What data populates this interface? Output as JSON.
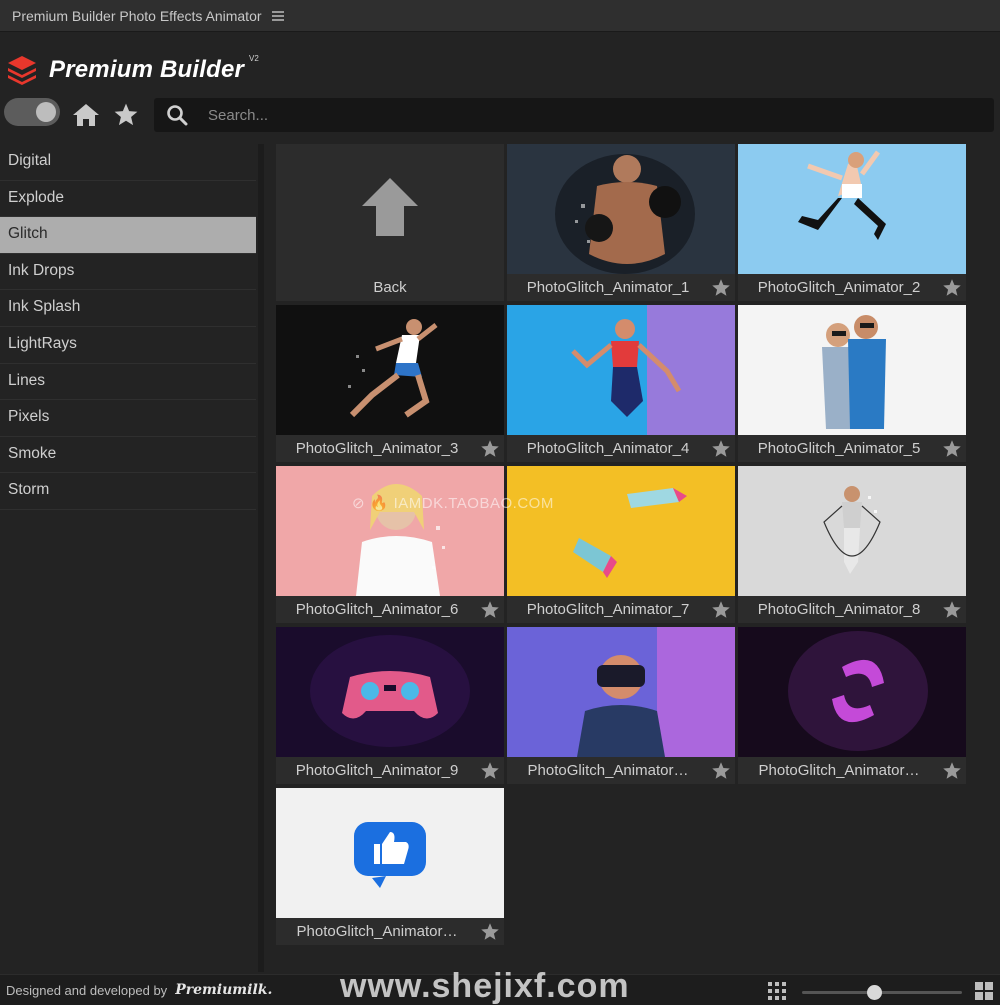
{
  "window": {
    "title": "Premium Builder Photo Effects Animator"
  },
  "brand": {
    "name": "Premium Builder",
    "version": "V2",
    "logo_icon": "layers-icon",
    "logo_color": "#e8372c"
  },
  "toolbar": {
    "toggle_icon": "toggle-switch-icon",
    "home_icon": "home-icon",
    "favorites_icon": "star-icon"
  },
  "search": {
    "placeholder": "Search...",
    "value": ""
  },
  "sidebar": {
    "selected": "Glitch",
    "items": [
      {
        "label": "Digital"
      },
      {
        "label": "Explode"
      },
      {
        "label": "Glitch"
      },
      {
        "label": "Ink Drops"
      },
      {
        "label": "Ink Splash"
      },
      {
        "label": "LightRays"
      },
      {
        "label": "Lines"
      },
      {
        "label": "Pixels"
      },
      {
        "label": "Smoke"
      },
      {
        "label": "Storm"
      }
    ]
  },
  "grid": {
    "back_label": "Back",
    "back_icon": "arrow-up-icon",
    "items": [
      {
        "label": "PhotoGlitch_Animator_1",
        "bg": "#2a3440",
        "scene": "boxer"
      },
      {
        "label": "PhotoGlitch_Animator_2",
        "bg": "#8ccbf0",
        "scene": "jumper"
      },
      {
        "label": "PhotoGlitch_Animator_3",
        "bg": "#141414",
        "scene": "runner"
      },
      {
        "label": "PhotoGlitch_Animator_4",
        "bg": "#2aa4e6",
        "scene": "dancer"
      },
      {
        "label": "PhotoGlitch_Animator_5",
        "bg": "#f4f4f4",
        "scene": "couple"
      },
      {
        "label": "PhotoGlitch_Animator_6",
        "bg": "#f0a7a8",
        "scene": "woman"
      },
      {
        "label": "PhotoGlitch_Animator_7",
        "bg": "#f3bf25",
        "scene": "sneakers"
      },
      {
        "label": "PhotoGlitch_Animator_8",
        "bg": "#d9d9d9",
        "scene": "ropejump"
      },
      {
        "label": "PhotoGlitch_Animator_9",
        "bg": "#1d1030",
        "scene": "gamepad"
      },
      {
        "label": "PhotoGlitch_Animator…",
        "bg": "#6b63d8",
        "scene": "vr"
      },
      {
        "label": "PhotoGlitch_Animator…",
        "bg": "#1c0e22",
        "scene": "logo"
      },
      {
        "label": "PhotoGlitch_Animator…",
        "bg": "#f1f1f1",
        "scene": "like"
      }
    ],
    "favorite_icon": "star-icon"
  },
  "overlay_watermark": "⊘ 🔥 IAMDK.TAOBAO.COM",
  "footer": {
    "credit": "Designed and developed by",
    "signature": "Premiumilk.",
    "watermark": "www.shejixf.com",
    "list_view_icon": "list-view-icon",
    "grid_view_icon": "grid-view-icon",
    "thumbnail_size": 0.45
  }
}
